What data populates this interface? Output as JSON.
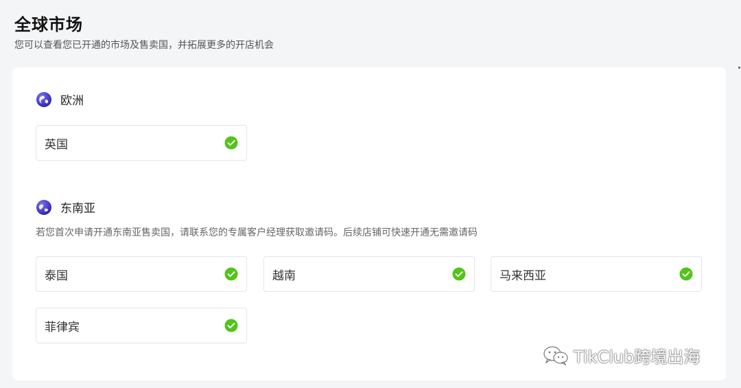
{
  "header": {
    "title": "全球市场",
    "subtitle": "您可以查看您已开通的市场及售卖国，并拓展更多的开店机会"
  },
  "regions": [
    {
      "name": "欧洲",
      "icon": "globe-icon",
      "note": "",
      "countries": [
        {
          "label": "英国",
          "status": "enabled"
        }
      ]
    },
    {
      "name": "东南亚",
      "icon": "globe-icon",
      "note": "若您首次申请开通东南亚售卖国，请联系您的专属客户经理获取邀请码。后续店铺可快速开通无需邀请码",
      "countries": [
        {
          "label": "泰国",
          "status": "enabled"
        },
        {
          "label": "越南",
          "status": "enabled"
        },
        {
          "label": "马来西亚",
          "status": "enabled"
        },
        {
          "label": "菲律宾",
          "status": "enabled"
        }
      ]
    }
  ],
  "watermark": {
    "text": "TikClub跨境出海",
    "icon": "wechat-icon"
  },
  "colors": {
    "check_green": "#52c41a",
    "globe_blue": "#3b2fc9",
    "card_border": "#e3e5e8"
  }
}
